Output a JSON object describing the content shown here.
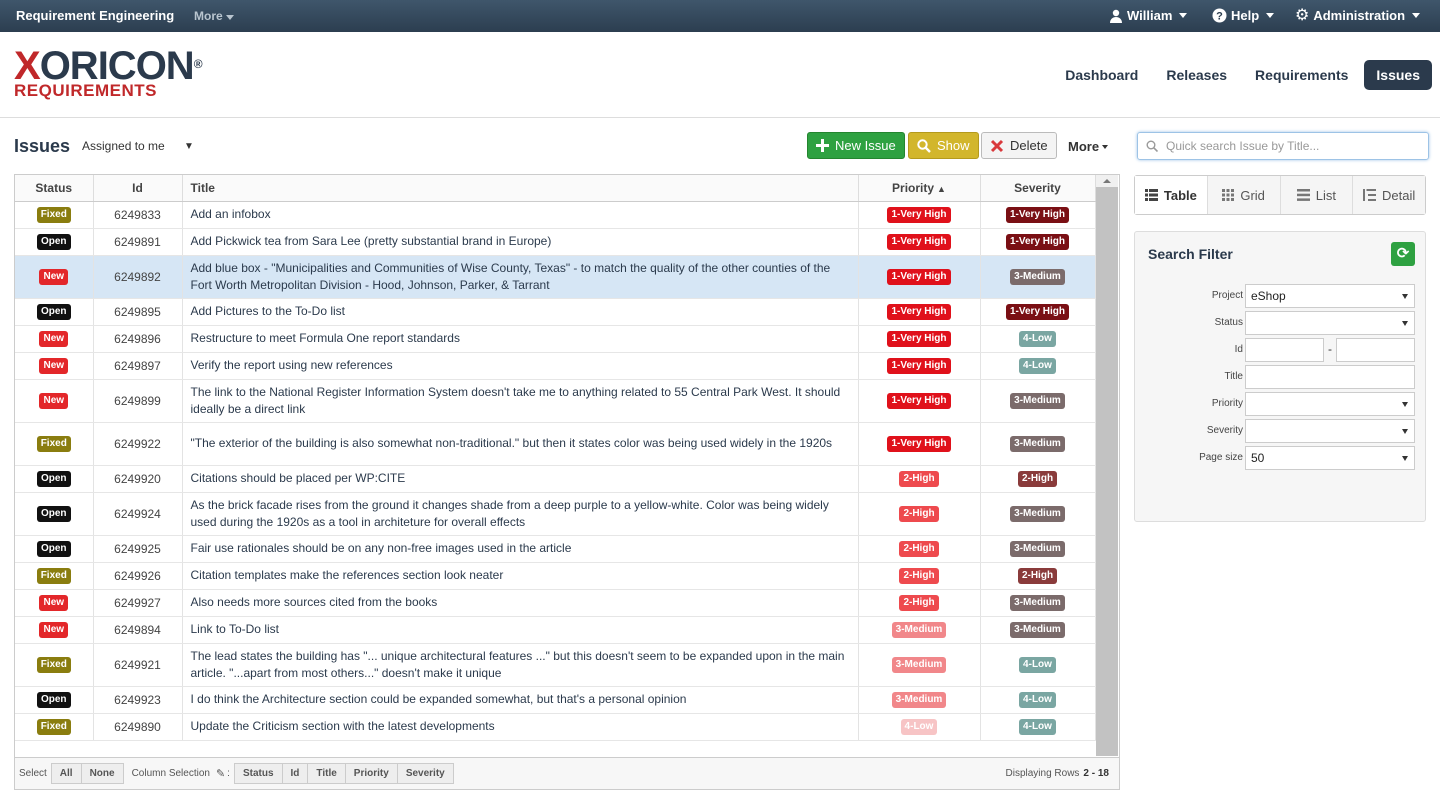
{
  "topbar": {
    "brand": "Requirement Engineering",
    "more": "More",
    "user": "William",
    "help": "Help",
    "admin": "Administration"
  },
  "logo": {
    "line1": "XORICON",
    "line2": "REQUIREMENTS"
  },
  "nav": {
    "tabs": [
      {
        "label": "Dashboard"
      },
      {
        "label": "Releases"
      },
      {
        "label": "Requirements"
      },
      {
        "label": "Issues"
      }
    ]
  },
  "toolbar": {
    "title": "Issues",
    "filter_value": "Assigned to me",
    "new_label": "New Issue",
    "show_label": "Show",
    "delete_label": "Delete",
    "more_label": "More"
  },
  "table": {
    "columns": [
      "Status",
      "Id",
      "Title",
      "Priority",
      "Severity"
    ],
    "rows": [
      {
        "status": "Fixed",
        "id": "6249833",
        "title": "Add an infobox",
        "priority": "1-Very High",
        "severity": "1-Very High"
      },
      {
        "status": "Open",
        "id": "6249891",
        "title": "Add Pickwick tea from Sara Lee (pretty substantial brand in Europe)",
        "priority": "1-Very High",
        "severity": "1-Very High"
      },
      {
        "status": "New",
        "id": "6249892",
        "title": "Add blue box - \"Municipalities and Communities of Wise County, Texas\" - to match the quality of the other counties of the Fort Worth Metropolitan Division - Hood, Johnson, Parker, & Tarrant",
        "priority": "1-Very High",
        "severity": "3-Medium"
      },
      {
        "status": "Open",
        "id": "6249895",
        "title": "Add Pictures to the To-Do list",
        "priority": "1-Very High",
        "severity": "1-Very High"
      },
      {
        "status": "New",
        "id": "6249896",
        "title": "Restructure to meet Formula One report standards",
        "priority": "1-Very High",
        "severity": "4-Low"
      },
      {
        "status": "New",
        "id": "6249897",
        "title": "Verify the report using new references",
        "priority": "1-Very High",
        "severity": "4-Low"
      },
      {
        "status": "New",
        "id": "6249899",
        "title": "The link to the National Register Information System doesn't take me to anything related to 55 Central Park West. It should ideally be a direct link",
        "priority": "1-Very High",
        "severity": "3-Medium"
      },
      {
        "status": "Fixed",
        "id": "6249922",
        "title": "\"The exterior of the building is also somewhat non-traditional.\" but then it states color was being used widely in the 1920s",
        "priority": "1-Very High",
        "severity": "3-Medium"
      },
      {
        "status": "Open",
        "id": "6249920",
        "title": "Citations should be placed per WP:CITE",
        "priority": "2-High",
        "severity": "2-High"
      },
      {
        "status": "Open",
        "id": "6249924",
        "title": "As the brick facade rises from the ground it changes shade from a deep purple to a yellow-white. Color was being widely used during the 1920s as a tool in architeture for overall effects",
        "priority": "2-High",
        "severity": "3-Medium"
      },
      {
        "status": "Open",
        "id": "6249925",
        "title": "Fair use rationales should be on any non-free images used in the article",
        "priority": "2-High",
        "severity": "3-Medium"
      },
      {
        "status": "Fixed",
        "id": "6249926",
        "title": "Citation templates make the references section look neater",
        "priority": "2-High",
        "severity": "2-High"
      },
      {
        "status": "New",
        "id": "6249927",
        "title": "Also needs more sources cited from the books",
        "priority": "2-High",
        "severity": "3-Medium"
      },
      {
        "status": "New",
        "id": "6249894",
        "title": "Link to To-Do list",
        "priority": "3-Medium",
        "severity": "3-Medium"
      },
      {
        "status": "Fixed",
        "id": "6249921",
        "title": "The lead states the building has \"... unique architectural features ...\" but this doesn't seem to be expanded upon in the main article. \"...apart from most others...\" doesn't make it unique",
        "priority": "3-Medium",
        "severity": "4-Low"
      },
      {
        "status": "Open",
        "id": "6249923",
        "title": "I do think the Architecture section could be expanded somewhat, but that's a personal opinion",
        "priority": "3-Medium",
        "severity": "4-Low"
      },
      {
        "status": "Fixed",
        "id": "6249890",
        "title": "Update the Criticism section with the latest developments",
        "priority": "4-Low",
        "severity": "4-Low"
      }
    ]
  },
  "colors": {
    "status": {
      "Fixed": "#8a7d0f",
      "Open": "#111111",
      "New": "#e3272a"
    },
    "priority": {
      "1-Very High": "#e0111b",
      "2-High": "#ee4a4e",
      "3-Medium": "#f1878a",
      "4-Low": "#f7c4c5"
    },
    "severity": {
      "1-Very High": "#7a0f14",
      "2-High": "#8a3b3b",
      "3-Medium": "#7b6b6b",
      "4-Low": "#7aa6a2"
    }
  },
  "footer": {
    "select_label": "Select",
    "all": "All",
    "none": "None",
    "column_selection": "Column Selection",
    "columns": [
      "Status",
      "Id",
      "Title",
      "Priority",
      "Severity"
    ],
    "displaying": "Displaying Rows",
    "range": "2 - 18"
  },
  "search": {
    "placeholder": "Quick search Issue by Title..."
  },
  "views": [
    "Table",
    "Grid",
    "List",
    "Detail"
  ],
  "filter": {
    "title": "Search Filter",
    "project_label": "Project",
    "project_value": "eShop",
    "status_label": "Status",
    "status_value": "",
    "id_label": "Id",
    "title_label": "Title",
    "priority_label": "Priority",
    "priority_value": "",
    "severity_label": "Severity",
    "severity_value": "",
    "pagesize_label": "Page size",
    "pagesize_value": "50"
  }
}
